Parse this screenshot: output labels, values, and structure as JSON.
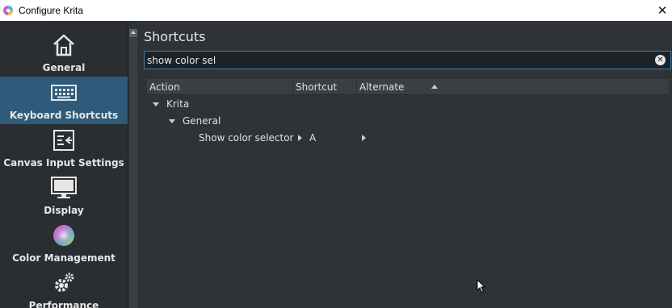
{
  "window": {
    "title": "Configure Krita",
    "close_glyph": "✕"
  },
  "sidebar": {
    "items": [
      {
        "label": "General",
        "icon": "home-icon"
      },
      {
        "label": "Keyboard Shortcuts",
        "icon": "keyboard-icon",
        "selected": true
      },
      {
        "label": "Canvas Input Settings",
        "icon": "canvas-input-icon"
      },
      {
        "label": "Display",
        "icon": "monitor-icon"
      },
      {
        "label": "Color Management",
        "icon": "color-wheel-icon"
      },
      {
        "label": "Performance",
        "icon": "gears-icon"
      }
    ]
  },
  "main": {
    "title": "Shortcuts",
    "search": {
      "value": "show color sel",
      "clear_glyph": "✕"
    },
    "columns": [
      "Action",
      "Shortcut",
      "Alternate"
    ],
    "tree": {
      "root": "Krita",
      "group": "General",
      "action": {
        "name": "Show color selector",
        "shortcut": "A",
        "alternate": ""
      }
    }
  },
  "colors": {
    "selected_bg": "#2f5a7a",
    "focus_border": "#3a7fb0",
    "background": "#2f3338"
  }
}
